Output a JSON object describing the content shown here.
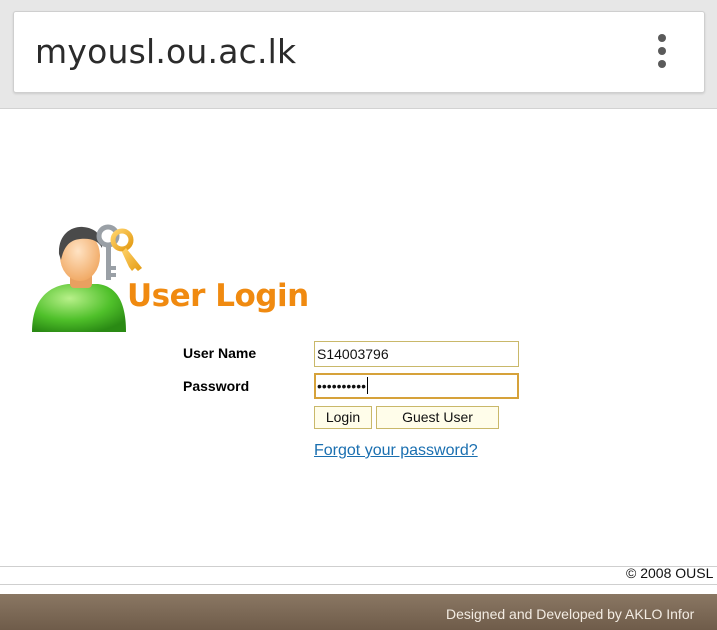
{
  "browser": {
    "url": "myousl.ou.ac.lk"
  },
  "login": {
    "title": "User Login",
    "username_label": "User Name",
    "password_label": "Password",
    "username_value": "S14003796",
    "password_mask": "••••••••••",
    "login_button": "Login",
    "guest_button": "Guest User",
    "forgot_link": "Forgot your password?"
  },
  "footer": {
    "copyright": "© 2008 OUSL",
    "credit": "Designed and Developed by AKLO Infor"
  },
  "colors": {
    "title_orange": "#f08a10",
    "link_blue": "#1a6fb0",
    "field_border": "#c9b86a",
    "footer_brown": "#7d6a56"
  },
  "icons": [
    "menu-dots-icon",
    "user-login-icon"
  ]
}
